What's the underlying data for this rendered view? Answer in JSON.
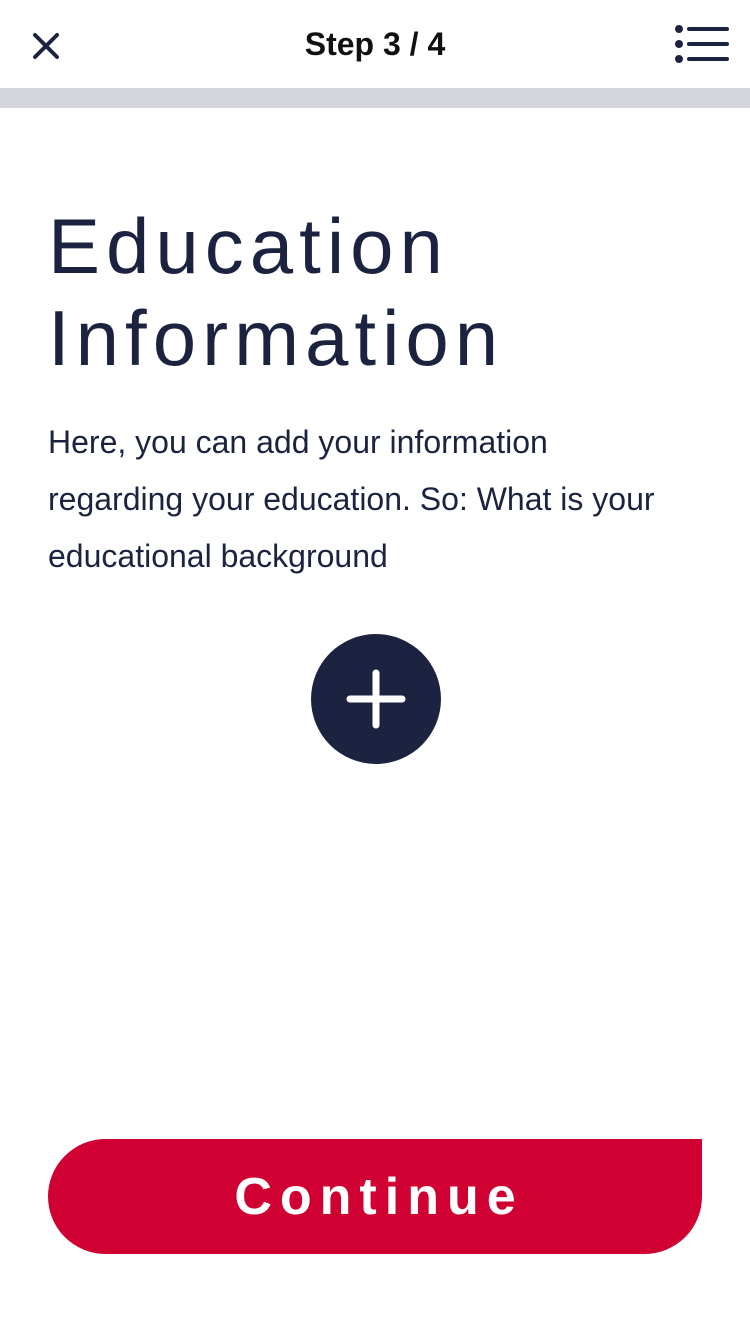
{
  "header": {
    "step_label": "Step 3 / 4",
    "close_icon": "close-icon",
    "menu_icon": "list-menu-icon"
  },
  "progress": {
    "current_step": 3,
    "total_steps": 4
  },
  "main": {
    "title": "Education Information",
    "description": "Here, you can add your information regarding your education. So: What is your educational background",
    "add_icon": "plus-icon"
  },
  "footer": {
    "continue_label": "Continue"
  },
  "colors": {
    "primary_navy": "#1c2340",
    "accent_red": "#d00032",
    "progress_track": "#d5d6db"
  }
}
